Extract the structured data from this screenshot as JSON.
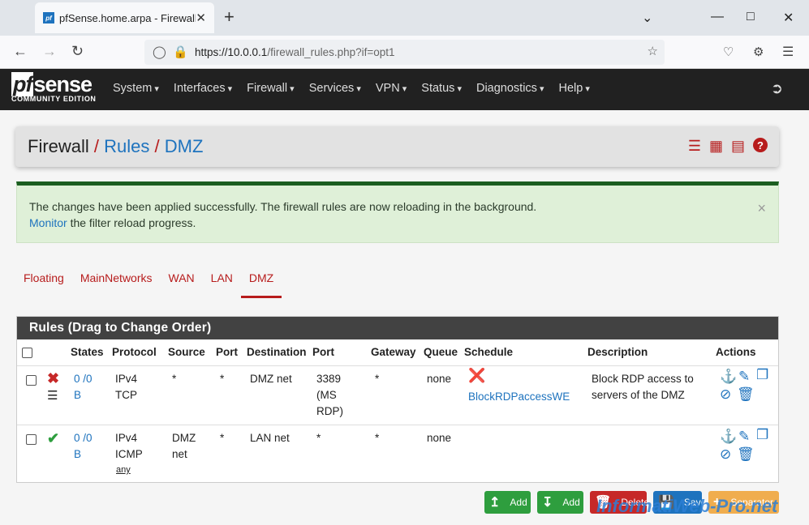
{
  "browser": {
    "tab_title": "pfSense.home.arpa - Firewall: R",
    "favicon": "pf",
    "url_host": "https://10.0.0.1",
    "url_path": "/firewall_rules.php?if=opt1",
    "new_tab": "+",
    "close": "✕"
  },
  "brand": {
    "name": "sense",
    "prefix": "pf",
    "edition": "COMMUNITY EDITION"
  },
  "menu": [
    "System",
    "Interfaces",
    "Firewall",
    "Services",
    "VPN",
    "Status",
    "Diagnostics",
    "Help"
  ],
  "breadcrumb": {
    "root": "Firewall",
    "mid": "Rules",
    "current": "DMZ",
    "sep": "/"
  },
  "alert": {
    "line1": "The changes have been applied successfully. The firewall rules are now reloading in the background.",
    "link": "Monitor",
    "line2": " the filter reload progress.",
    "close": "×"
  },
  "iface_tabs": [
    "Floating",
    "MainNetworks",
    "WAN",
    "LAN",
    "DMZ"
  ],
  "panel": {
    "title": "Rules (Drag to Change Order)"
  },
  "columns": [
    "States",
    "Protocol",
    "Source",
    "Port",
    "Destination",
    "Port",
    "Gateway",
    "Queue",
    "Schedule",
    "Description",
    "Actions"
  ],
  "rows": [
    {
      "states": "0 /0",
      "states2": "B",
      "proto": "IPv4",
      "proto2": "TCP",
      "proto3": "",
      "source": "*",
      "source2": "",
      "sport": "*",
      "dest": "DMZ net",
      "dport": "3389",
      "dport2": "(MS",
      "dport3": "RDP)",
      "gateway": "*",
      "queue": "none",
      "schedule": "BlockRDPaccessWE",
      "desc": "Block RDP access to",
      "desc2": "servers of the DMZ",
      "status": "block"
    },
    {
      "states": "0 /0",
      "states2": "B",
      "proto": "IPv4",
      "proto2": "ICMP",
      "proto3": "any",
      "source": "DMZ",
      "source2": "net",
      "sport": "*",
      "dest": "LAN net",
      "dport": "*",
      "dport2": "",
      "dport3": "",
      "gateway": "*",
      "queue": "none",
      "schedule": "",
      "desc": "",
      "desc2": "",
      "status": "pass"
    }
  ],
  "buttons": {
    "add_top": "Add",
    "add_bottom": "Add",
    "delete": "Delete",
    "save": "Save",
    "separator": "Separator"
  },
  "watermark": "InformatiWeb-Pro.net",
  "colors": {
    "accent": "#b71c1c",
    "link": "#1e73be",
    "success": "#2e9e3e",
    "warning": "#f0ad4e",
    "danger": "#c62828"
  }
}
